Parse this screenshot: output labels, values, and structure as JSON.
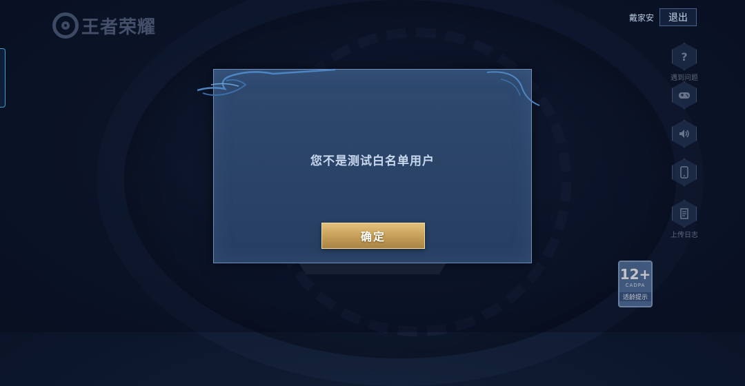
{
  "header": {
    "logo_text": "王者荣耀",
    "username": "戴家安",
    "logout_label": "退出"
  },
  "side_menu": {
    "items": [
      {
        "icon": "question-icon",
        "label": "遇到问题"
      },
      {
        "icon": "gamepad-icon",
        "label": ""
      },
      {
        "icon": "speaker-icon",
        "label": ""
      },
      {
        "icon": "phone-icon",
        "label": ""
      },
      {
        "icon": "document-icon",
        "label": "上传日志"
      }
    ]
  },
  "age_rating": {
    "age": "12+",
    "org": "CADPA",
    "tip": "适龄提示"
  },
  "dialog": {
    "message": "您不是测试白名单用户",
    "confirm_label": "确定"
  },
  "colors": {
    "background": "#0f1a30",
    "dialog": "#2c4669",
    "confirm_gold": "#c7a05a",
    "accent_cyan": "#3aa0c8"
  }
}
